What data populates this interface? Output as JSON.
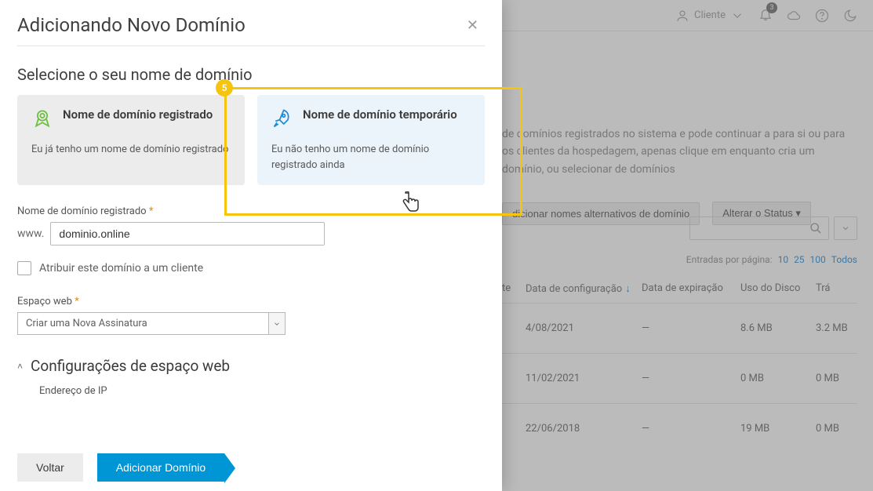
{
  "topbar": {
    "client_label": "Cliente",
    "bell_count": "3"
  },
  "bg_info_text": "de domínios registrados no sistema e pode continuar a para si ou para os clientes da hospedagem, apenas clique em enquanto cria um domínio, ou selecionar de domínios",
  "bg_actions": {
    "alt_names": "dicionar nomes alternativos de domínio",
    "status": "Alterar o Status"
  },
  "perpage": {
    "label": "Entradas por página:",
    "o1": "10",
    "o2": "25",
    "o3": "100",
    "o4": "Todos"
  },
  "table": {
    "headers": {
      "c1": "te",
      "c2": "Data de configuração",
      "sort": "↓",
      "c3": "Data de expiração",
      "c4": "Uso do Disco",
      "c5": "Trá"
    },
    "rows": [
      {
        "c1": "",
        "c2": "4/08/2021",
        "c3": "—",
        "c4": "8.6 MB",
        "c5": "3.2 MB"
      },
      {
        "c1": "",
        "c2": "11/02/2021",
        "c3": "—",
        "c4": "0 MB",
        "c5": "0 MB"
      },
      {
        "c1": "",
        "c2": "22/06/2018",
        "c3": "—",
        "c4": "19 MB",
        "c5": "0 MB"
      }
    ]
  },
  "modal": {
    "title": "Adicionando Novo Domínio",
    "section_title": "Selecione o seu nome de domínio",
    "card_reg": {
      "title": "Nome de domínio registrado",
      "desc": "Eu já tenho um nome de domínio registrado"
    },
    "card_tmp": {
      "title": "Nome de domínio temporário",
      "desc": "Eu não tenho um nome de domínio registrado ainda"
    },
    "field_domain_label": "Nome de domínio registrado",
    "field_domain_prefix": "www.",
    "field_domain_value": "dominio.online",
    "assign_label": "Atribuir este domínio a um cliente",
    "webspace_label": "Espaço web",
    "webspace_value": "Criar uma Nova Assinatura",
    "config_title": "Configurações de espaço web",
    "ip_label": "Endereço de IP",
    "btn_back": "Voltar",
    "btn_submit": "Adicionar Domínio"
  },
  "callout": {
    "num": "5"
  }
}
